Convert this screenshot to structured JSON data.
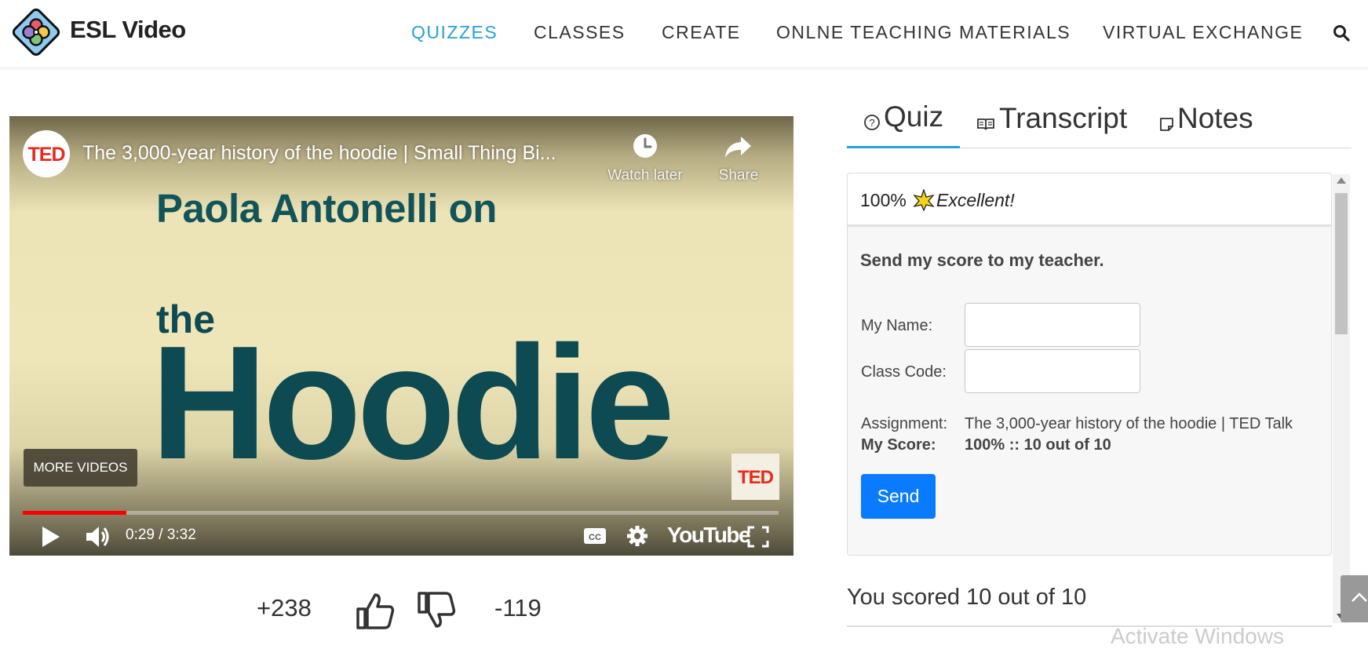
{
  "header": {
    "brand": "ESL Video",
    "nav": [
      {
        "label": "QUIZZES",
        "active": true
      },
      {
        "label": "CLASSES",
        "active": false
      },
      {
        "label": "CREATE",
        "active": false
      },
      {
        "label": "ONLNE TEACHING MATERIALS",
        "active": false
      },
      {
        "label": "VIRTUAL EXCHANGE",
        "active": false
      }
    ],
    "search_icon": "search-icon"
  },
  "video": {
    "channel_badge": "TED",
    "title": "The 3,000-year history of the hoodie | Small Thing Bi...",
    "watch_later": "Watch later",
    "share": "Share",
    "slide_line1": "Paola Antonelli on",
    "slide_line2": "the",
    "slide_line3": "Hoodie",
    "more_videos": "MORE VIDEOS",
    "corner_logo": "TED",
    "time": "0:29 / 3:32",
    "progress": 0.137,
    "youtube_label": "YouTube"
  },
  "rating": {
    "up_count": "+238",
    "down_count": "-119"
  },
  "tabs": [
    {
      "label": "Quiz",
      "icon": "question-circle-icon",
      "active": true
    },
    {
      "label": "Transcript",
      "icon": "book-icon",
      "active": false
    },
    {
      "label": "Notes",
      "icon": "note-icon",
      "active": false
    }
  ],
  "quiz_panel": {
    "percent": "100%",
    "rating_word": "Excellent!",
    "send_title": "Send my score to my teacher.",
    "name_label": "My Name:",
    "name_value": "",
    "class_code_label": "Class Code:",
    "class_code_value": "",
    "assignment_label": "Assignment:",
    "assignment_value": "The 3,000-year history of the hoodie | TED Talk",
    "score_label": "My Score:",
    "score_value": "100% :: 10 out of 10",
    "send_button": "Send"
  },
  "result_text": "You scored 10 out of 10",
  "watermark": "Activate Windows",
  "colors": {
    "accent": "#2a9fd8",
    "send_button": "#0a7bff",
    "progress": "#ff0000",
    "ted_red": "#e62b1e",
    "slide_text": "#0f4a52"
  }
}
